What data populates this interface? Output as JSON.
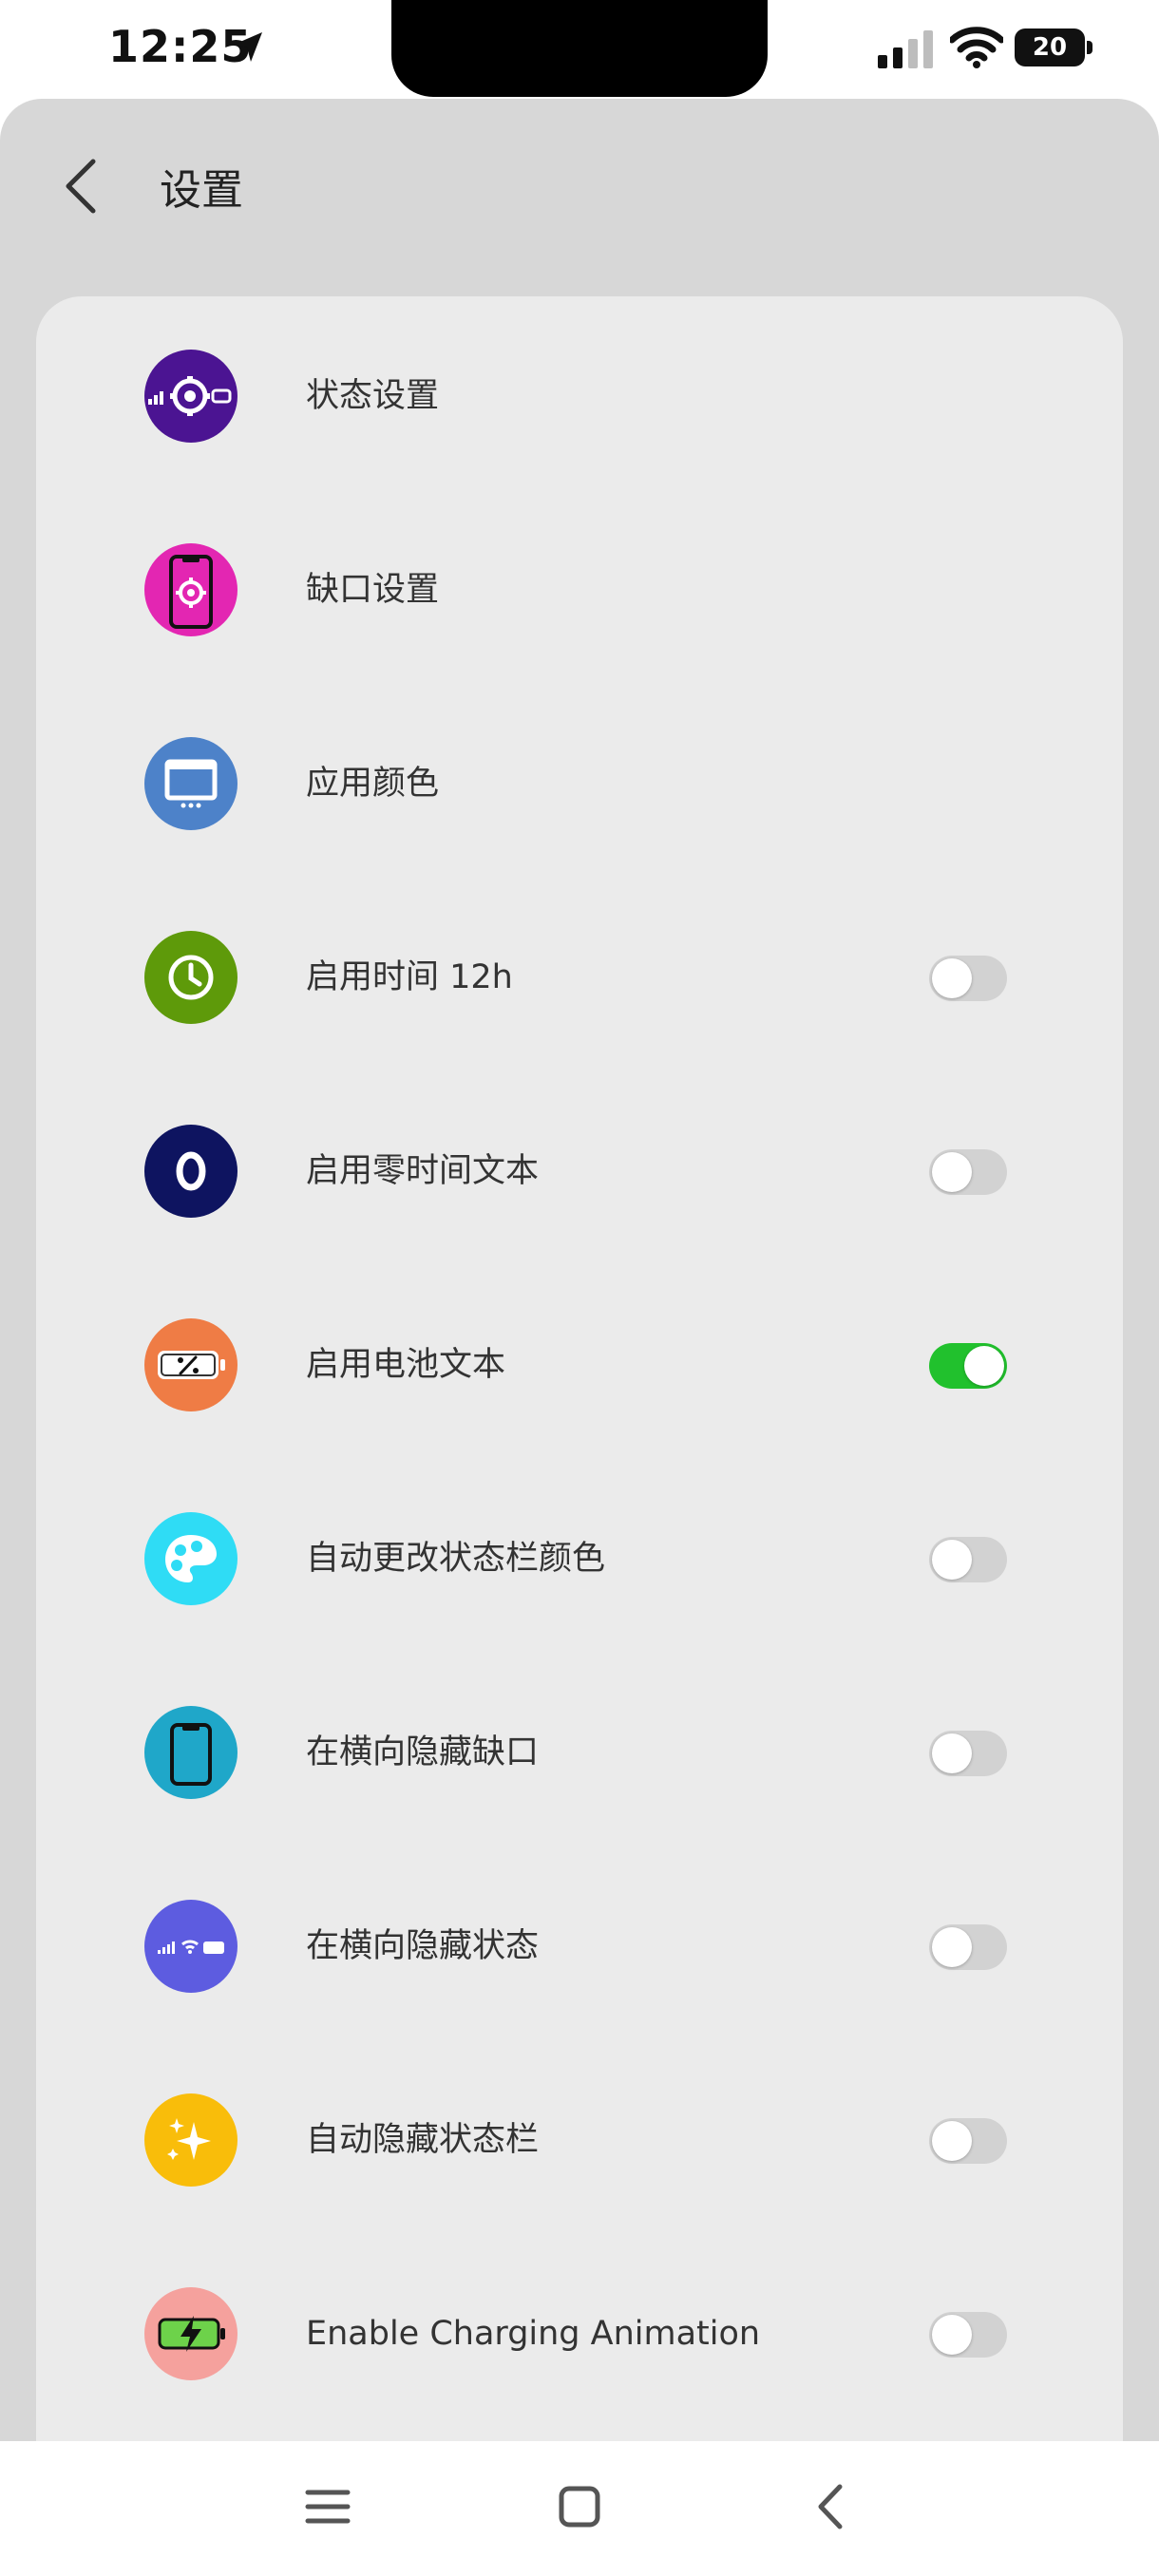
{
  "status_bar": {
    "time": "12:25",
    "battery": "20"
  },
  "header": {
    "title": "设置"
  },
  "settings": [
    {
      "label": "状态设置",
      "icon": "status-settings-icon",
      "color": "#4b1492",
      "toggle": null
    },
    {
      "label": "缺口设置",
      "icon": "notch-settings-icon",
      "color": "#e326b2",
      "toggle": null
    },
    {
      "label": "应用颜色",
      "icon": "app-color-icon",
      "color": "#4d82c9",
      "toggle": null
    },
    {
      "label": "启用时间 12h",
      "icon": "clock-icon",
      "color": "#5e9a0a",
      "toggle": false
    },
    {
      "label": "启用零时间文本",
      "icon": "zero-icon",
      "color": "#0e1460",
      "toggle": false
    },
    {
      "label": "启用电池文本",
      "icon": "battery-percent-icon",
      "color": "#ef7c45",
      "toggle": true
    },
    {
      "label": "自动更改状态栏颜色",
      "icon": "palette-icon",
      "color": "#2fdcf5",
      "toggle": false
    },
    {
      "label": "在横向隐藏缺口",
      "icon": "phone-notch-icon",
      "color": "#1fa7c9",
      "toggle": false
    },
    {
      "label": "在横向隐藏状态",
      "icon": "status-bar-icon",
      "color": "#5d5ce0",
      "toggle": false
    },
    {
      "label": "自动隐藏状态栏",
      "icon": "sparkle-icon",
      "color": "#f9bd0a",
      "toggle": false
    },
    {
      "label": "Enable Charging Animation",
      "icon": "charging-icon",
      "color": "#f5a19d",
      "toggle": false
    }
  ],
  "colors": {
    "toggle_on": "#21c12d",
    "toggle_off": "#d2d2d2"
  }
}
